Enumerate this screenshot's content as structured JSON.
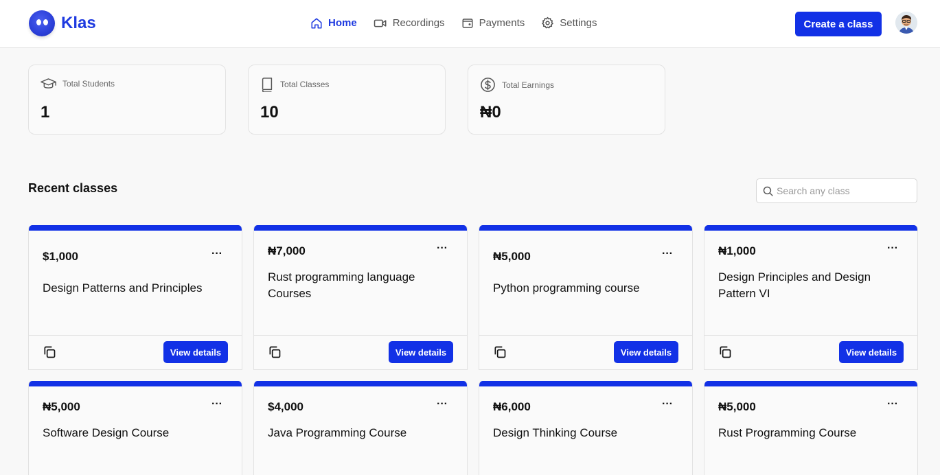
{
  "brand": {
    "name": "Klas",
    "accent": "#1231e6"
  },
  "nav": [
    {
      "label": "Home",
      "icon": "home-icon",
      "active": true
    },
    {
      "label": "Recordings",
      "icon": "video-icon",
      "active": false
    },
    {
      "label": "Payments",
      "icon": "wallet-icon",
      "active": false
    },
    {
      "label": "Settings",
      "icon": "gear-icon",
      "active": false
    }
  ],
  "header": {
    "create_label": "Create a class"
  },
  "stats": [
    {
      "label": "Total Students",
      "value": "1",
      "icon": "graduation-cap-icon"
    },
    {
      "label": "Total Classes",
      "value": "10",
      "icon": "book-icon"
    },
    {
      "label": "Total Earnings",
      "value": "₦0",
      "icon": "currency-icon"
    }
  ],
  "recent": {
    "title": "Recent classes",
    "search_placeholder": "Search any class",
    "view_label": "View details",
    "menu_label": "···",
    "classes": [
      {
        "price": "$1,000",
        "title": "Design Patterns and Principles"
      },
      {
        "price": "₦7,000",
        "title": "Rust programming language Courses"
      },
      {
        "price": "₦5,000",
        "title": "Python programming course"
      },
      {
        "price": "₦1,000",
        "title": "Design Principles and Design Pattern VI"
      },
      {
        "price": "₦5,000",
        "title": "Software Design Course"
      },
      {
        "price": "$4,000",
        "title": "Java Programming Course"
      },
      {
        "price": "₦6,000",
        "title": "Design Thinking Course"
      },
      {
        "price": "₦5,000",
        "title": "Rust Programming Course"
      }
    ]
  }
}
